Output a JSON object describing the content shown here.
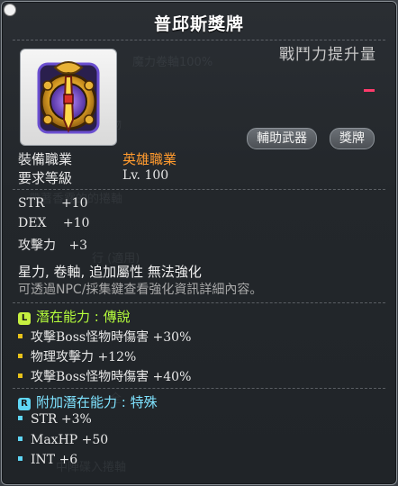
{
  "title": "普邱斯獎牌",
  "power_label": "戰鬥力提升量",
  "tags": [
    "輔助武器",
    "獎牌"
  ],
  "requirements": {
    "job_label": "裝備職業",
    "job_value": "英雄職業",
    "level_label": "要求等級",
    "level_value": "Lv. 100"
  },
  "stats": [
    {
      "name": "STR",
      "value": "+10"
    },
    {
      "name": "DEX",
      "value": "+10"
    },
    {
      "name": "攻擊力",
      "value": "+3"
    }
  ],
  "notes": {
    "line1": "星力, 卷軸, 追加屬性 無法強化",
    "line2": "可透過NPC/採集鍵查看強化資訊詳細內容。"
  },
  "potential": {
    "badge": "L",
    "header": "潛在能力 : 傳說",
    "lines": [
      "攻擊Boss怪物時傷害 +30%",
      "物理攻擊力 +12%",
      "攻擊Boss怪物時傷害 +40%"
    ]
  },
  "additional": {
    "badge": "R",
    "header": "附加潛在能力 : 特殊",
    "lines": [
      "STR +3%",
      "MaxHP +50",
      "INT +6"
    ]
  },
  "colors": {
    "job_value": "#ff9a2e",
    "potential_header": "#b6ff3c",
    "potential_badge": "#c6f040",
    "potential_dot": "#e8c21a",
    "additional_header": "#7fe3ff",
    "additional_badge": "#5fd6f5",
    "additional_dot": "#5fd6f5",
    "note_dim": "#a9a9a9",
    "power_value": "#ff3b6b"
  },
  "icons": {
    "item": "medal-emblem-icon"
  }
}
